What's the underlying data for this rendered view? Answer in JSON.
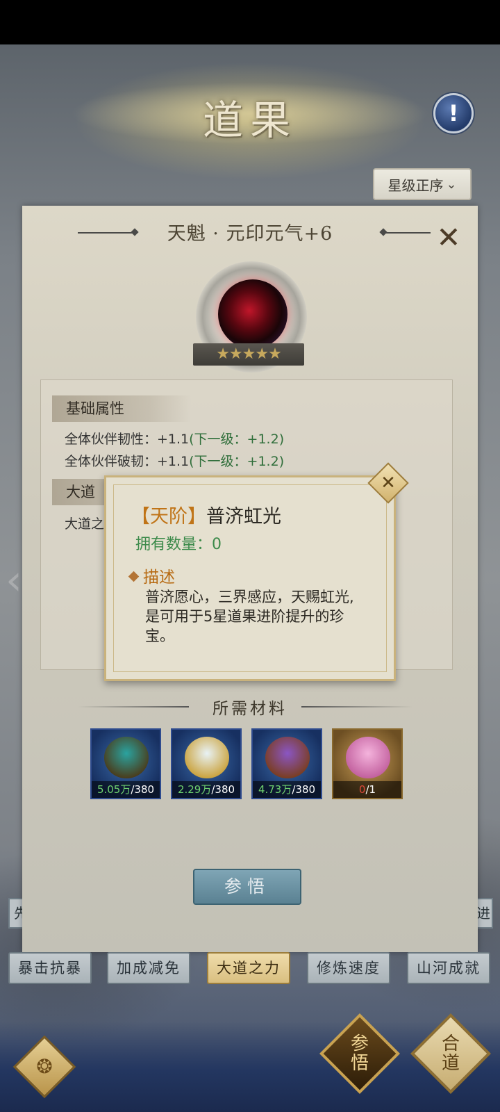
{
  "header": {
    "title": "道果",
    "help_icon": "!",
    "sort_label": "星级正序"
  },
  "panel": {
    "title": "天魁 · 元印元气+6",
    "stars": "★★★★★",
    "base_attr_label": "基础属性",
    "attrs": [
      {
        "text": "全体伙伴韧性：+1.1",
        "next": "(下一级：+1.2)"
      },
      {
        "text": "全体伙伴破韧：+1.1",
        "next": "(下一级：+1.2)"
      }
    ],
    "dao_label": "大道",
    "dao_line": "大道之"
  },
  "materials": {
    "title": "所需材料",
    "items": [
      {
        "have": "5.05万",
        "need": "/380",
        "enough": true,
        "colors": [
          "#2aa3a0",
          "#4a3b1a"
        ]
      },
      {
        "have": "2.29万",
        "need": "/380",
        "enough": true,
        "colors": [
          "#e8f2f5",
          "#caa23c"
        ]
      },
      {
        "have": "4.73万",
        "need": "/380",
        "enough": true,
        "colors": [
          "#8a56c4",
          "#7a3d1f"
        ]
      },
      {
        "have": "0",
        "need": "/1",
        "enough": false,
        "colors": [
          "#f4b3dc",
          "#c2609e"
        ]
      }
    ]
  },
  "enlighten_button": "参悟",
  "peek_tabs": {
    "left": "先",
    "right": "进"
  },
  "tabs": [
    {
      "label": "暴击抗暴",
      "active": false
    },
    {
      "label": "加成减免",
      "active": false
    },
    {
      "label": "大道之力",
      "active": true
    },
    {
      "label": "修炼速度",
      "active": false
    },
    {
      "label": "山河成就",
      "active": false
    }
  ],
  "bottom": {
    "enlighten_top": "参",
    "enlighten_bottom": "悟",
    "unite_top": "合",
    "unite_bottom": "道",
    "back_glyph": "❂"
  },
  "popup": {
    "tier": "【天阶】",
    "name": "普济虹光",
    "count_label": "拥有数量：0",
    "desc_label": "描述",
    "desc": "普济愿心，三界感应，天赐虹光,是可用于5星道果进阶提升的珍宝。"
  }
}
